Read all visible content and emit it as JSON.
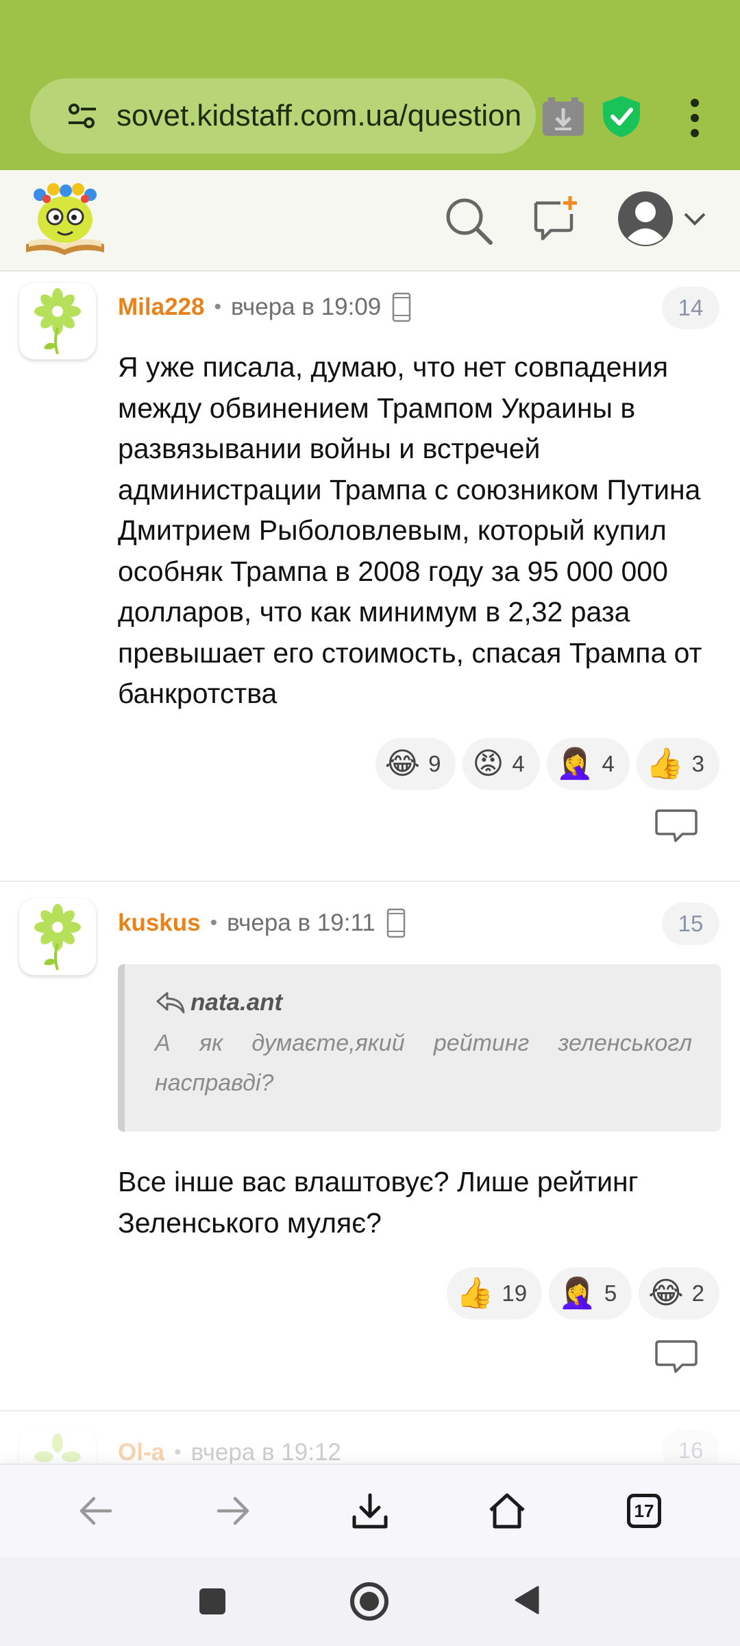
{
  "browser": {
    "url": "sovet.kidstaff.com.ua/question",
    "tab_count": "17"
  },
  "comments": [
    {
      "author": "Mila228",
      "time": "вчера в 19:09",
      "number": "14",
      "text": "Я уже писала, думаю, что нет совпадения между обвинением Трампом Украины в развязывании войны и встречей администрации Трампа с союзником Путина Дмитрием Рыболовлевым, который купил особняк Трампа в 2008 году за 95 000 000 долларов, что как минимум в 2,32 раза превышает его стоимость, спасая Трампа от банкротства",
      "reactions": [
        {
          "emoji": "😂",
          "count": "9"
        },
        {
          "emoji": "😡",
          "count": "4"
        },
        {
          "emoji": "🤦‍♀️",
          "count": "4"
        },
        {
          "emoji": "👍",
          "count": "3"
        }
      ]
    },
    {
      "author": "kuskus",
      "time": "вчера в 19:11",
      "number": "15",
      "quote_author": "nata.ant",
      "quote_text": "А як думаєте,який рейтинг зеленськогл насправді?",
      "text": "Все інше вас влаштовує? Лише рейтинг Зеленського муляє?",
      "reactions": [
        {
          "emoji": "👍",
          "count": "19"
        },
        {
          "emoji": "🤦‍♀️",
          "count": "5"
        },
        {
          "emoji": "😂",
          "count": "2"
        }
      ]
    },
    {
      "author": "Ol-a",
      "time": "вчера в 19:12",
      "number": "16"
    }
  ],
  "colors": {
    "chrome_bg": "#9ec147",
    "author": "#e8821a"
  }
}
